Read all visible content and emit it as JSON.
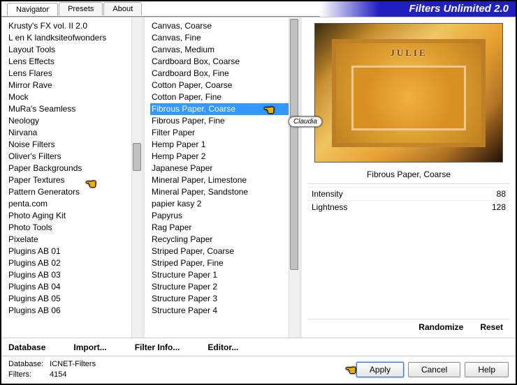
{
  "title": "Filters Unlimited 2.0",
  "tabs": [
    "Navigator",
    "Presets",
    "About"
  ],
  "activeTab": 0,
  "categories": [
    "Krusty's FX vol. II 2.0",
    "L en K landksiteofwonders",
    "Layout Tools",
    "Lens Effects",
    "Lens Flares",
    "Mirror Rave",
    "Mock",
    "MuRa's Seamless",
    "Neology",
    "Nirvana",
    "Noise Filters",
    "Oliver's Filters",
    "Paper Backgrounds",
    "Paper Textures",
    "Pattern Generators",
    "penta.com",
    "Photo Aging Kit",
    "Photo Tools",
    "Pixelate",
    "Plugins AB 01",
    "Plugins AB 02",
    "Plugins AB 03",
    "Plugins AB 04",
    "Plugins AB 05",
    "Plugins AB 06"
  ],
  "selectedCategoryIndex": 13,
  "filters": [
    "Canvas, Coarse",
    "Canvas, Fine",
    "Canvas, Medium",
    "Cardboard Box, Coarse",
    "Cardboard Box, Fine",
    "Cotton Paper, Coarse",
    "Cotton Paper, Fine",
    "Fibrous Paper, Coarse",
    "Fibrous Paper, Fine",
    "Filter Paper",
    "Hemp Paper 1",
    "Hemp Paper 2",
    "Japanese Paper",
    "Mineral Paper, Limestone",
    "Mineral Paper, Sandstone",
    "papier kasy 2",
    "Papyrus",
    "Rag Paper",
    "Recycling Paper",
    "Striped Paper, Coarse",
    "Striped Paper, Fine",
    "Structure Paper 1",
    "Structure Paper 2",
    "Structure Paper 3",
    "Structure Paper 4"
  ],
  "selectedFilterIndex": 7,
  "previewName": "JULIE",
  "signature": "Claudia",
  "currentFilter": "Fibrous Paper, Coarse",
  "params": [
    {
      "label": "Intensity",
      "value": 88
    },
    {
      "label": "Lightness",
      "value": 128
    }
  ],
  "rightButtons": {
    "randomize": "Randomize",
    "reset": "Reset"
  },
  "footerButtons": [
    "Database",
    "Import...",
    "Filter Info...",
    "Editor..."
  ],
  "status": {
    "dbLabel": "Database:",
    "dbValue": "ICNET-Filters",
    "filtersLabel": "Filters:",
    "filtersValue": "4154"
  },
  "bottomButtons": {
    "apply": "Apply",
    "cancel": "Cancel",
    "help": "Help"
  }
}
